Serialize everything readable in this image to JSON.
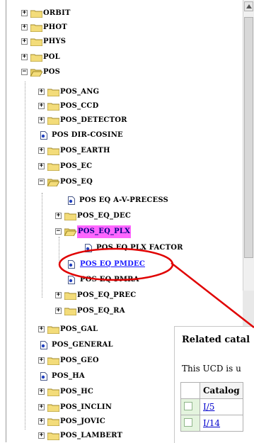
{
  "tree": [
    {
      "label": "ORBIT",
      "toggle": "+"
    },
    {
      "label": "PHOT",
      "toggle": "+"
    },
    {
      "label": "PHYS",
      "toggle": "+"
    },
    {
      "label": "POL",
      "toggle": "+"
    },
    {
      "label": "POS",
      "toggle": "−"
    },
    {
      "label": "POS_ANG",
      "toggle": "+"
    },
    {
      "label": "POS_CCD",
      "toggle": "+"
    },
    {
      "label": "POS_DETECTOR",
      "toggle": "+"
    },
    {
      "label": "POS DIR-COSINE"
    },
    {
      "label": "POS_EARTH",
      "toggle": "+"
    },
    {
      "label": "POS_EC",
      "toggle": "+"
    },
    {
      "label": "POS_EQ",
      "toggle": "−"
    },
    {
      "label": "POS EQ A-V-PRECESS"
    },
    {
      "label": "POS_EQ_DEC",
      "toggle": "+"
    },
    {
      "label": "POS_EQ_PLX",
      "toggle": "−"
    },
    {
      "label": "POS EQ PLX FACTOR"
    },
    {
      "label": "POS EQ PMDEC"
    },
    {
      "label": "POS EQ PMRA"
    },
    {
      "label": "POS_EQ_PREC",
      "toggle": "+"
    },
    {
      "label": "POS_EQ_RA",
      "toggle": "+"
    },
    {
      "label": "POS_GAL",
      "toggle": "+"
    },
    {
      "label": "POS_GENERAL"
    },
    {
      "label": "POS_GEO",
      "toggle": "+"
    },
    {
      "label": "POS_HA"
    },
    {
      "label": "POS_HC",
      "toggle": "+"
    },
    {
      "label": "POS_INCLIN",
      "toggle": "+"
    },
    {
      "label": "POS_JOVIC",
      "toggle": "+"
    },
    {
      "label": "POS_LAMBERT",
      "toggle": "+"
    }
  ],
  "catalog_panel": {
    "title": "Related catal",
    "description": "This UCD is u",
    "column_header": "Catalog",
    "rows": [
      "I/5",
      "I/14"
    ]
  },
  "colors": {
    "selected_background": "#ff66ff",
    "link": "#1a1aff",
    "annotation": "#e00000",
    "folder": "#f3dc7a"
  }
}
